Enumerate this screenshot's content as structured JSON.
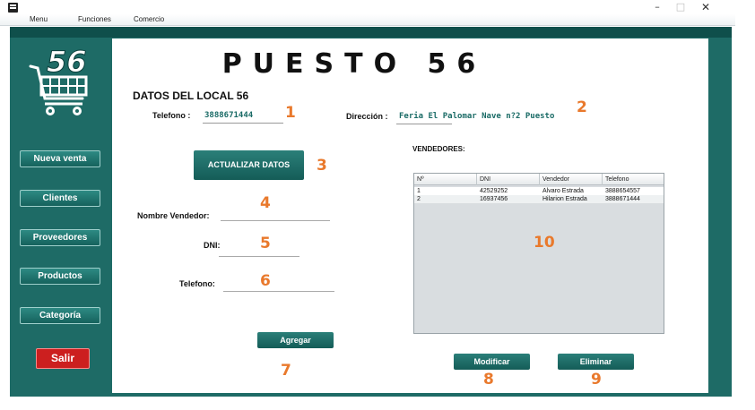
{
  "window": {
    "minimize": "–",
    "maximize": "□",
    "close": "✕"
  },
  "menu": [
    "Menu",
    "Funciones",
    "Comercio"
  ],
  "logo": {
    "number": "56",
    "icon": "shopping-cart-icon"
  },
  "sidebar": {
    "buttons": [
      "Nueva venta",
      "Clientes",
      "Proveedores",
      "Productos",
      "Categoría"
    ],
    "exit": "Salir"
  },
  "page_title": "PUESTO 56",
  "local": {
    "heading": "DATOS DEL LOCAL 56",
    "phone_label": "Telefono :",
    "phone_value": "3888671444",
    "address_label": "Dirección :",
    "address_value": "Feria El Palomar Nave n?2 Puesto",
    "update_button": "ACTUALIZAR DATOS"
  },
  "form": {
    "name_label": "Nombre Vendedor:",
    "dni_label": "DNI:",
    "phone_label": "Telefono:",
    "add_button": "Agregar"
  },
  "vendors": {
    "heading": "VENDEDORES:",
    "columns": [
      "Nº",
      "DNI",
      "Vendedor",
      "Telefono"
    ],
    "rows": [
      [
        "1",
        "42529252",
        "Alvaro Estrada",
        "3888654557"
      ],
      [
        "2",
        "16937456",
        "Hilarion Estrada",
        "3888671444"
      ]
    ],
    "modify_button": "Modificar",
    "delete_button": "Eliminar"
  },
  "annotations": [
    "1",
    "2",
    "3",
    "4",
    "5",
    "6",
    "7",
    "8",
    "9",
    "10"
  ],
  "colors": {
    "teal": "#1e6b66",
    "accent_orange": "#e9792c",
    "exit_red": "#cc1f1f"
  }
}
